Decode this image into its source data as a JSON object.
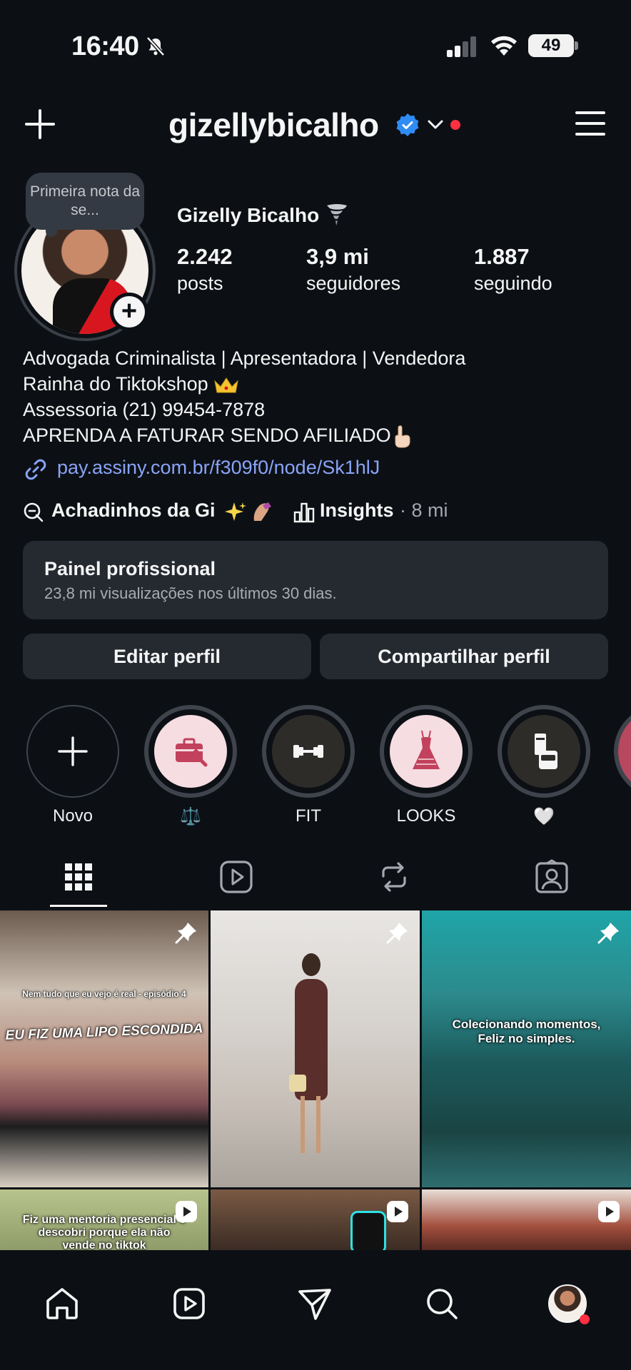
{
  "status_bar": {
    "time": "16:40",
    "battery": "49"
  },
  "header": {
    "username": "gizellybicalho"
  },
  "note": {
    "text": "Primeira nota da se..."
  },
  "profile": {
    "full_name": "Gizelly Bicalho",
    "stats": [
      {
        "value": "2.242",
        "label": "posts"
      },
      {
        "value": "3,9 mi",
        "label": "seguidores"
      },
      {
        "value": "1.887",
        "label": "seguindo"
      }
    ],
    "bio": [
      "Advogada Criminalista | Apresentadora | Vendedora",
      "Rainha do Tiktokshop",
      "Assessoria (21) 99454-7878",
      "APRENDA A FATURAR SENDO AFILIADO"
    ],
    "link": "pay.assiny.com.br/f309f0/node/Sk1hlJ",
    "thread_chip": "Achadinhos da Gi",
    "insights_label": "Insights",
    "insights_count": "· 8 mi"
  },
  "panel": {
    "title": "Painel profissional",
    "subtitle": "23,8 mi visualizações nos últimos 30 dias."
  },
  "buttons": {
    "edit": "Editar perfil",
    "share": "Compartilhar perfil"
  },
  "highlights": [
    {
      "label": "Novo",
      "icon": "plus-icon"
    },
    {
      "label": "⚖️",
      "icon": "briefcase-icon"
    },
    {
      "label": "FIT",
      "icon": "dumbbell-icon"
    },
    {
      "label": "LOOKS",
      "icon": "dress-icon"
    },
    {
      "label": "🤍",
      "icon": "cosmetics-icon"
    }
  ],
  "tabs": [
    "grid-icon",
    "reels-icon",
    "reposts-icon",
    "tagged-icon"
  ],
  "grid": [
    {
      "caption_top": "Nem tudo que eu vejo é real - episódio 4",
      "caption_main": "EU FIZ UMA LIPO ESCONDIDA",
      "badge": "pin-icon"
    },
    {
      "caption_main": "",
      "badge": "pin-icon"
    },
    {
      "caption_main": "Colecionando momentos,\nFeliz no simples.",
      "badge": "pin-icon"
    },
    {
      "caption_main": "Fiz uma mentoria presencial e descobri porque ela não vende no tiktok",
      "badge": "reels-icon"
    },
    {
      "caption_main": "",
      "badge": "reels-icon"
    },
    {
      "caption_main": "",
      "badge": "reels-icon"
    }
  ],
  "colors": {
    "background": "#0c1015",
    "surface": "#252a31",
    "link": "#8aa4f6",
    "verified": "#2f8cf5",
    "notification": "#ff3040"
  }
}
